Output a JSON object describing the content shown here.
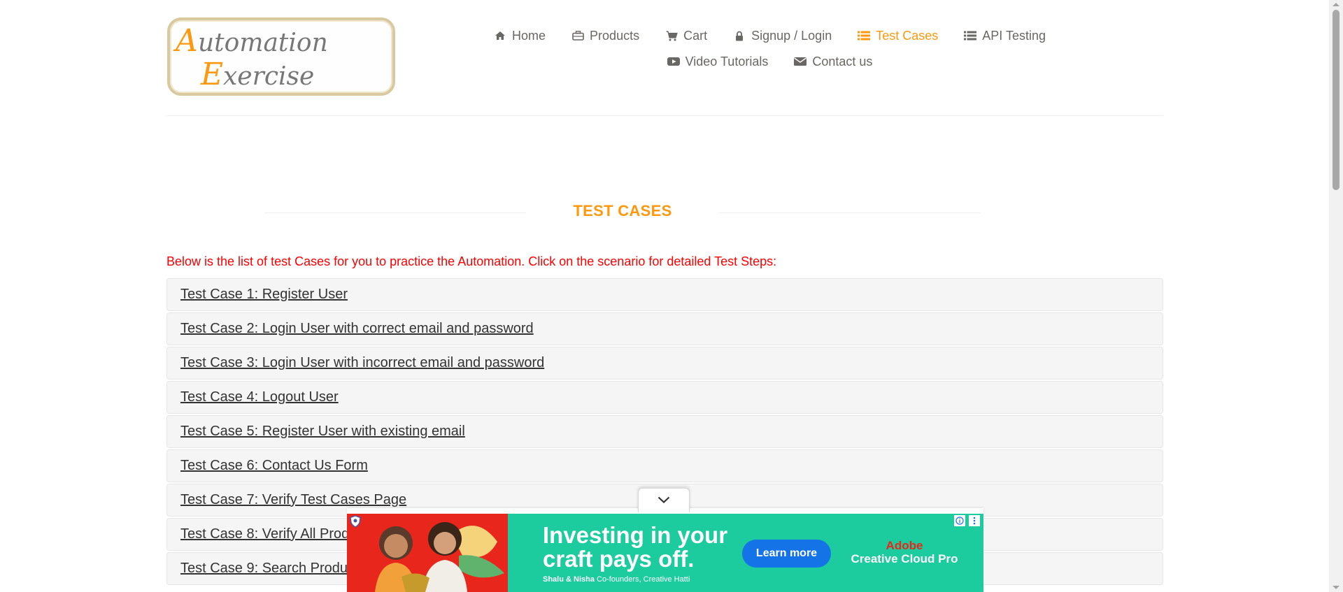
{
  "logo": {
    "line1_first": "A",
    "line1_rest": "utomation",
    "line2_first": "E",
    "line2_rest": "xercise"
  },
  "nav": {
    "row1": [
      {
        "label": "Home",
        "icon": "home-icon",
        "active": false
      },
      {
        "label": "Products",
        "icon": "briefcase-icon",
        "active": false
      },
      {
        "label": "Cart",
        "icon": "shopping-cart-icon",
        "active": false
      },
      {
        "label": "Signup / Login",
        "icon": "lock-icon",
        "active": false
      },
      {
        "label": "Test Cases",
        "icon": "list-icon",
        "active": true
      },
      {
        "label": "API Testing",
        "icon": "list-icon",
        "active": false
      }
    ],
    "row2": [
      {
        "label": "Video Tutorials",
        "icon": "youtube-play-icon",
        "active": false
      },
      {
        "label": "Contact us",
        "icon": "envelope-icon",
        "active": false
      }
    ]
  },
  "main": {
    "title": "TEST CASES",
    "intro": "Below is the list of test Cases for you to practice the Automation. Click on the scenario for detailed Test Steps:",
    "cases": [
      "Test Case 1: Register User",
      "Test Case 2: Login User with correct email and password",
      "Test Case 3: Login User with incorrect email and password",
      "Test Case 4: Logout User",
      "Test Case 5: Register User with existing email",
      "Test Case 6: Contact Us Form",
      "Test Case 7: Verify Test Cases Page",
      "Test Case 8: Verify All Products and product detail page",
      "Test Case 9: Search Product"
    ]
  },
  "ad": {
    "headline_1": "Investing in your",
    "headline_2": "craft pays off.",
    "sub_names": "Shalu & Nisha",
    "sub_rest": " Co-founders, Creative Hatti",
    "cta": "Learn more",
    "brand_1": "Adobe",
    "brand_2": "Creative Cloud Pro"
  },
  "colors": {
    "accent": "#fe980f",
    "intro_red": "#ff0000",
    "ad_green": "#1ccb9e",
    "ad_red": "#e8261b",
    "ad_button": "#1473e6"
  }
}
